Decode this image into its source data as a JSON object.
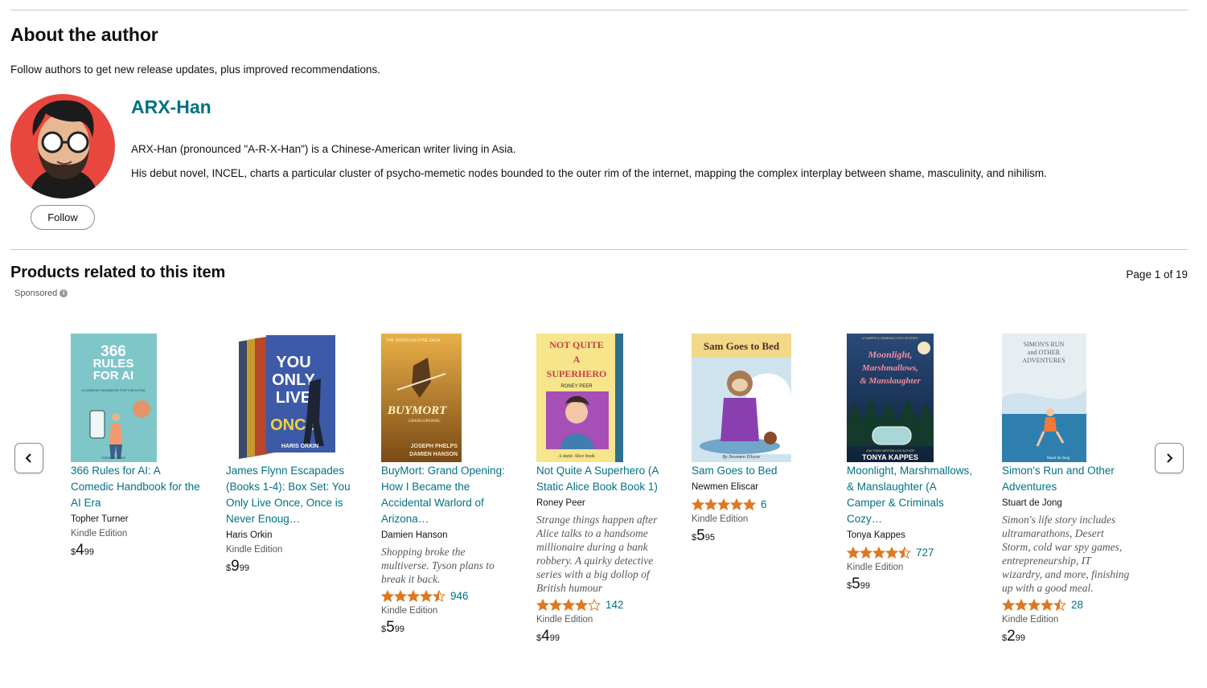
{
  "about": {
    "heading": "About the author",
    "follow_note": "Follow authors to get new release updates, plus improved recommendations.",
    "follow_label": "Follow",
    "author_name": "ARX-Han",
    "bio_line1": "ARX-Han (pronounced \"A-R-X-Han\") is a Chinese-American writer living in Asia.",
    "bio_line2": "His debut novel, INCEL, charts a particular cluster of psycho-memetic nodes bounded to the outer rim of the internet, mapping the complex interplay between shame, masculinity, and nihilism."
  },
  "products": {
    "heading": "Products related to this item",
    "page_indicator": "Page 1 of 19",
    "sponsored": "Sponsored",
    "items": [
      {
        "title": "366 Rules for AI: A Comedic Handbook for the AI Era",
        "author": "Topher Turner",
        "blurb": "",
        "rating": null,
        "review_count": "",
        "format": "Kindle Edition",
        "price_sym": "$",
        "price_whole": "4",
        "price_frac": "99",
        "cover_colors": [
          "#7fc6c9",
          "#ffffff"
        ]
      },
      {
        "title": "James Flynn Escapades (Books 1-4): Box Set: You Only Live Once, Once is Never Enoug…",
        "author": "Haris Orkin",
        "blurb": "",
        "rating": null,
        "review_count": "",
        "format": "Kindle Edition",
        "price_sym": "$",
        "price_whole": "9",
        "price_frac": "99",
        "cover_colors": [
          "#3d5aa8",
          "#1d2433"
        ]
      },
      {
        "title": "BuyMort: Grand Opening: How I Became the Accidental Warlord of Arizona…",
        "author": "Damien Hanson",
        "blurb": "Shopping broke the multiverse. Tyson plans to break it back.",
        "rating": 4.5,
        "review_count": "946",
        "format": "Kindle Edition",
        "price_sym": "$",
        "price_whole": "5",
        "price_frac": "99",
        "cover_colors": [
          "#b0721e",
          "#e9b048"
        ]
      },
      {
        "title": "Not Quite A Superhero (A Static Alice Book Book 1)",
        "author": "Roney Peer",
        "blurb": "Strange things happen after Alice talks to a handsome millionaire during a bank robbery. A quirky detective series with a big dollop of British humour",
        "rating": 4.0,
        "review_count": "142",
        "format": "Kindle Edition",
        "price_sym": "$",
        "price_whole": "4",
        "price_frac": "99",
        "cover_colors": [
          "#f6e58a",
          "#2c6f8f"
        ]
      },
      {
        "title": "Sam Goes to Bed",
        "author": "Newmen Eliscar",
        "blurb": "",
        "rating": 5.0,
        "review_count": "6",
        "format": "Kindle Edition",
        "price_sym": "$",
        "price_whole": "5",
        "price_frac": "95",
        "cover_colors": [
          "#f2d98a",
          "#8a3fb0"
        ]
      },
      {
        "title": "Moonlight, Marshmallows, & Manslaughter (A Camper & Criminals Cozy…",
        "author": "Tonya Kappes",
        "blurb": "",
        "rating": 4.5,
        "review_count": "727",
        "format": "Kindle Edition",
        "price_sym": "$",
        "price_whole": "5",
        "price_frac": "99",
        "cover_colors": [
          "#1f3a5a",
          "#d8344a"
        ]
      },
      {
        "title": "Simon's Run and Other Adventures",
        "author": "Stuart de Jong",
        "blurb": "Simon's life story includes ultramarathons, Desert Storm, cold war spy games, entrepreneurship, IT wizardry, and more, finishing up with a good meal.",
        "rating": 4.5,
        "review_count": "28",
        "format": "Kindle Edition",
        "price_sym": "$",
        "price_whole": "2",
        "price_frac": "99",
        "cover_colors": [
          "#cfe2ee",
          "#2f7fae"
        ]
      }
    ]
  },
  "cover_text": {
    "c0_top": "366",
    "c0_mid": "RULES",
    "c0_bot": "FOR AI",
    "c0_sub": "A COMEDIC HANDBOOK FOR THE AI ERA",
    "c0_author": "TOPHER TURNER",
    "c1_once": "ONCE",
    "c1_you": "YOU",
    "c1_only": "ONLY",
    "c1_live": "LIVE",
    "c1_author": "HARIS ORKIN",
    "c2_saga": "THE SHOPOCALYPSE SAGA",
    "c2_title": "BUYMORT",
    "c2_sub": "GRAND OPENING",
    "c2_auth1": "JOSEPH PHELPS",
    "c2_auth2": "DAMIEN HANSON",
    "c3_l1": "NOT QUITE",
    "c3_l2": "A",
    "c3_l3": "SUPERHERO",
    "c3_author": "RONEY PEER",
    "c3_series": "A static Alice book",
    "c4_title": "Sam Goes to Bed",
    "c4_author": "By Newmen Eliscar",
    "c5_top": "A CAMPER & CRIMINALS COZY MYSTERY",
    "c5_l1": "Moonlight,",
    "c5_l2": "Marshmallows,",
    "c5_l3": "& Manslaughter",
    "c5_bs": "USA TODAY BESTSELLING AUTHOR",
    "c5_author": "TONYA KAPPES",
    "c6_l1": "SIMON'S RUN",
    "c6_l2": "and OTHER",
    "c6_l3": "ADVENTURES",
    "c6_author": "Stuart de Jong"
  },
  "icons": {
    "prev": "chevron-left-icon",
    "next": "chevron-right-icon",
    "info": "info-icon",
    "star": "star-icon"
  },
  "colors": {
    "link": "#007185",
    "star": "#de7921",
    "text": "#0f1111",
    "muted": "#565959"
  }
}
